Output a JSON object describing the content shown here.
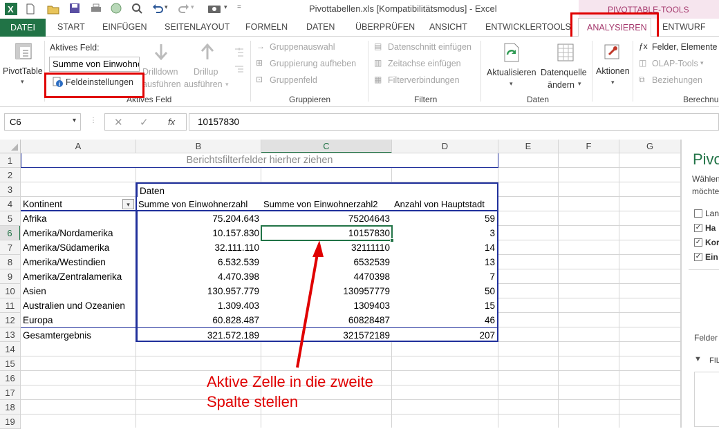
{
  "window": {
    "title": "Pivottabellen.xls  [Kompatibilitätsmodus] - Excel",
    "context_tab_group": "PIVOTTABLE-TOOLS"
  },
  "tabs": {
    "file": "DATEI",
    "start": "START",
    "insert": "EINFÜGEN",
    "layout": "SEITENLAYOUT",
    "formulas": "FORMELN",
    "data": "DATEN",
    "review": "ÜBERPRÜFEN",
    "view": "ANSICHT",
    "dev": "ENTWICKLERTOOLS",
    "analyze": "ANALYSIEREN",
    "design": "ENTWURF"
  },
  "ribbon": {
    "pivottable": "PivotTable",
    "active_field_label": "Aktives Feld:",
    "active_field_value": "Summe von Einwohne",
    "field_settings": "Feldeinstellungen",
    "drilldown_1": "Drilldown",
    "drilldown_2": "ausführen",
    "drillup_1": "Drillup",
    "drillup_2": "ausführen",
    "group_active_field": "Aktives Feld",
    "group_selection": "Gruppenauswahl",
    "ungroup": "Gruppierung aufheben",
    "group_field": "Gruppenfeld",
    "group_grouping": "Gruppieren",
    "insert_slicer": "Datenschnitt einfügen",
    "insert_timeline": "Zeitachse einfügen",
    "filter_connections": "Filterverbindungen",
    "group_filter": "Filtern",
    "refresh": "Aktualisieren",
    "change_source_1": "Datenquelle",
    "change_source_2": "ändern",
    "group_data": "Daten",
    "actions": "Aktionen",
    "fields_items": "Felder, Elemente",
    "olap_tools": "OLAP-Tools",
    "relationships": "Beziehungen",
    "group_calc": "Berechnu"
  },
  "formula_bar": {
    "name_box": "C6",
    "fx": "fx",
    "value": "10157830"
  },
  "columns": [
    "A",
    "B",
    "C",
    "D",
    "E",
    "F",
    "G"
  ],
  "rows": [
    "1",
    "2",
    "3",
    "4",
    "5",
    "6",
    "7",
    "8",
    "9",
    "10",
    "11",
    "12",
    "13",
    "14",
    "15",
    "16",
    "17",
    "18",
    "19"
  ],
  "sheet": {
    "report_filter_hint": "Berichtsfilterfelder hierher ziehen",
    "data_header": "Daten",
    "row_label": "Kontinent",
    "value_headers": [
      "Summe von Einwohnerzahl",
      "Summe von Einwohnerzahl2",
      "Anzahl von Hauptstadt"
    ],
    "rows": [
      {
        "name": "Afrika",
        "b": "75.204.643",
        "c": "75204643",
        "d": "59"
      },
      {
        "name": "Amerika/Nordamerika",
        "b": "10.157.830",
        "c": "10157830",
        "d": "3"
      },
      {
        "name": "Amerika/Südamerika",
        "b": "32.111.110",
        "c": "32111110",
        "d": "14"
      },
      {
        "name": "Amerika/Westindien",
        "b": "6.532.539",
        "c": "6532539",
        "d": "13"
      },
      {
        "name": "Amerika/Zentralamerika",
        "b": "4.470.398",
        "c": "4470398",
        "d": "7"
      },
      {
        "name": "Asien",
        "b": "130.957.779",
        "c": "130957779",
        "d": "50"
      },
      {
        "name": "Australien und Ozeanien",
        "b": "1.309.403",
        "c": "1309403",
        "d": "15"
      },
      {
        "name": "Europa",
        "b": "60.828.487",
        "c": "60828487",
        "d": "46"
      },
      {
        "name": "Gesamtergebnis",
        "b": "321.572.189",
        "c": "321572189",
        "d": "207"
      }
    ]
  },
  "annotation": {
    "line1": "Aktive Zelle in die zweite",
    "line2": "Spalte stellen"
  },
  "taskpane": {
    "title": "Pivo",
    "choose_1": "Wählen",
    "choose_2": "möchte",
    "fields": [
      "Lan",
      "Ha",
      "Kor",
      "Ein"
    ],
    "fields_label": "Felder",
    "filter_label": "FIL"
  },
  "colors": {
    "excel_green": "#217346",
    "context_purple": "#a4376c",
    "annotation_red": "#e00000",
    "pivot_border": "#1f2f9b"
  }
}
